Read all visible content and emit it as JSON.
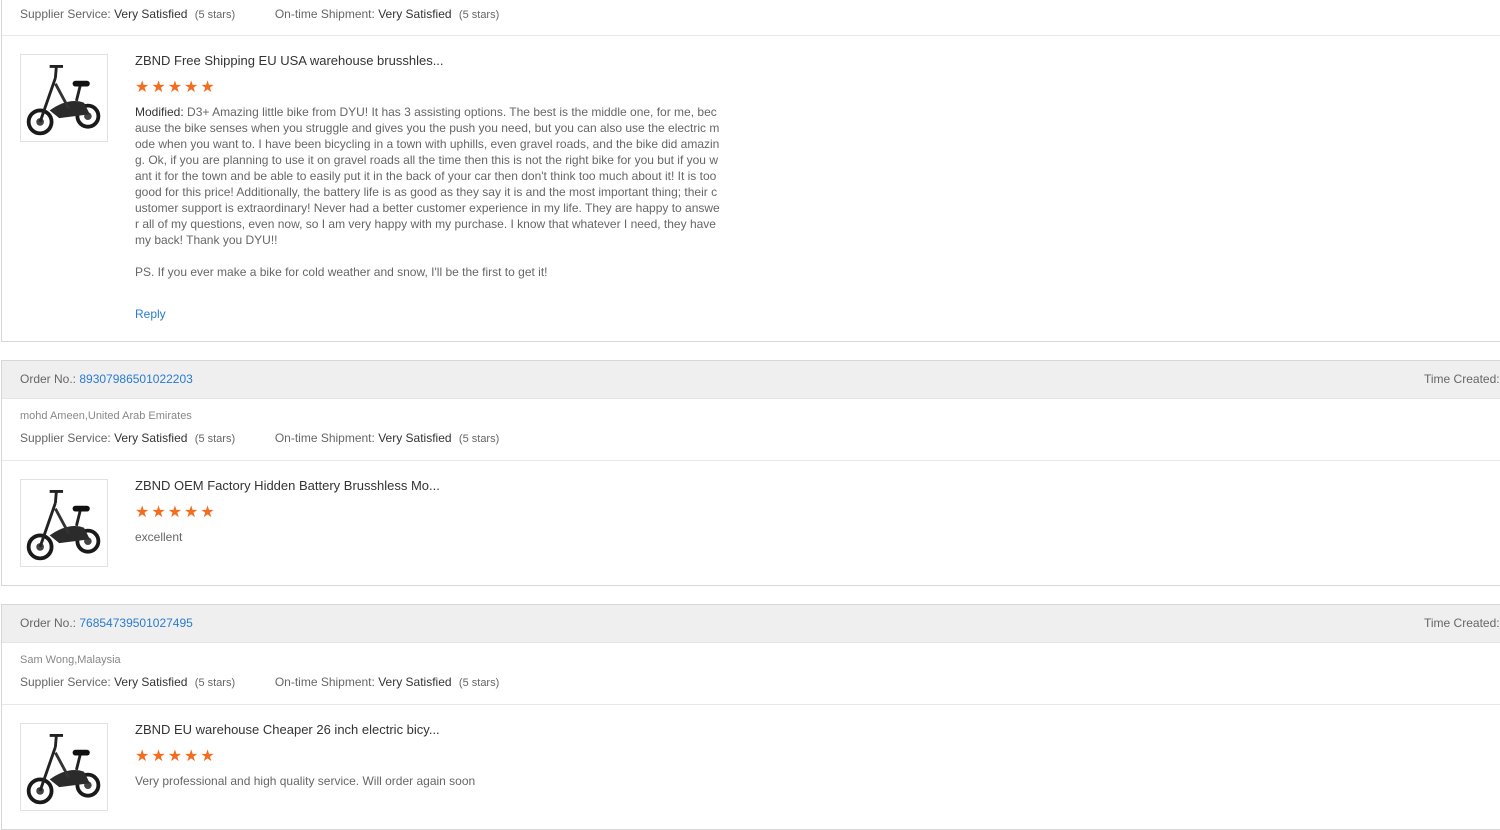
{
  "labels": {
    "supplier_service": "Supplier Service:",
    "on_time_shipment": "On-time Shipment:",
    "order_no": "Order No.:",
    "time_created": "Time Created:",
    "modified": "Modified:",
    "reply": "Reply"
  },
  "colors": {
    "star": "#f36d21",
    "link": "#2a7bd0",
    "header_bg": "#efefef"
  },
  "reviews": [
    {
      "supplier_rating": "Very Satisfied",
      "supplier_stars": "(5 stars)",
      "shipment_rating": "Very Satisfied",
      "shipment_stars": "(5 stars)",
      "product_name": "ZBND Free Shipping EU USA warehouse brusshles...",
      "stars": "★★★★★",
      "review_text": "D3+ Amazing little bike from DYU! It has 3 assisting options. The best is the middle one, for me, because the bike senses when you struggle and gives you the push you need, but you can also use the electric mode when you want to. I have been bicycling in a town with uphills, even gravel roads, and the bike did amazing. Ok, if you are planning to use it on gravel roads all the time then this is not the right bike for you but if you want it for the town and be able to easily put it in the back of your car then don't think too much about it! It is too good for this price! Additionally, the battery life is as good as they say it is and the most important thing; their customer support is extraordinary! Never had a better customer experience in my life. They are happy to answer all of my questions, even now, so I am very happy with my purchase. I know that whatever I need, they have my back! Thank you DYU!!",
      "review_ps": "PS. If you ever make a bike for cold weather and snow, I'll be the first to get it!"
    },
    {
      "order_no": "89307986501022203",
      "buyer": "mohd Ameen,United Arab Emirates",
      "supplier_rating": "Very Satisfied",
      "supplier_stars": "(5 stars)",
      "shipment_rating": "Very Satisfied",
      "shipment_stars": "(5 stars)",
      "product_name": "ZBND OEM Factory Hidden Battery Brusshless Mo...",
      "stars": "★★★★★",
      "review_text": "excellent"
    },
    {
      "order_no": "76854739501027495",
      "buyer": "Sam Wong,Malaysia",
      "supplier_rating": "Very Satisfied",
      "supplier_stars": "(5 stars)",
      "shipment_rating": "Very Satisfied",
      "shipment_stars": "(5 stars)",
      "product_name": "ZBND EU warehouse Cheaper 26 inch electric bicy...",
      "stars": "★★★★★",
      "review_text": "Very professional and high quality service. Will order again soon"
    }
  ]
}
